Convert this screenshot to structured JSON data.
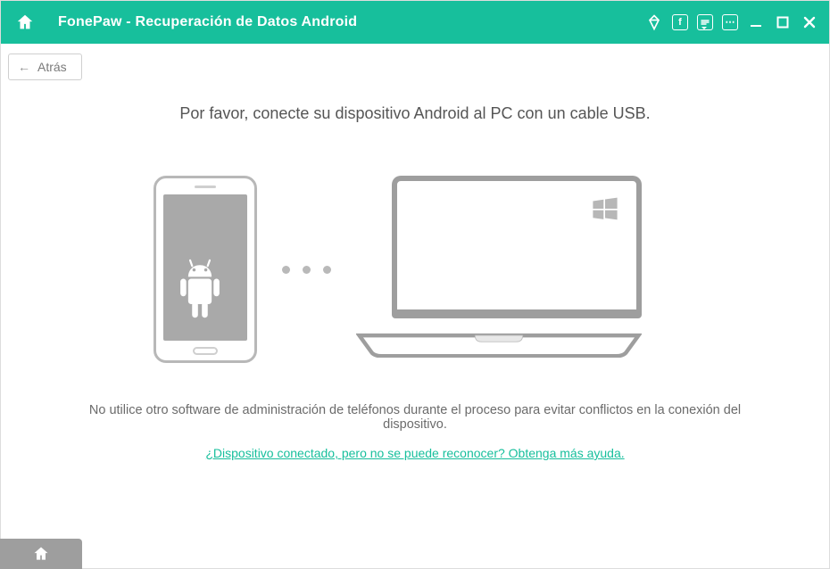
{
  "titlebar": {
    "title": "FonePaw - Recuperación de Datos Android"
  },
  "toolbar": {
    "back_label": "Atrás"
  },
  "main": {
    "headline": "Por favor, conecte su dispositivo Android al PC con un cable USB.",
    "notice": "No utilice otro software de administración de teléfonos durante el proceso para evitar conflictos en la conexión del dispositivo.",
    "help_link": "¿Dispositivo conectado, pero no se puede reconocer? Obtenga más ayuda."
  }
}
